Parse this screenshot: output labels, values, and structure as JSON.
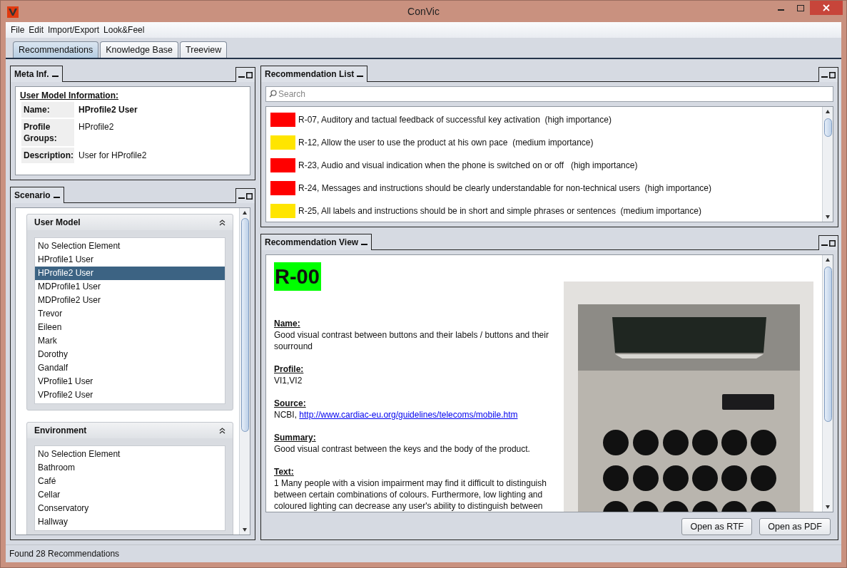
{
  "window": {
    "title": "ConVic"
  },
  "menu": [
    "File",
    "Edit",
    "Import/Export",
    "Look&Feel"
  ],
  "tabs": [
    {
      "label": "Recommendations",
      "selected": true
    },
    {
      "label": "Knowledge Base",
      "selected": false
    },
    {
      "label": "Treeview",
      "selected": false
    }
  ],
  "meta_panel": {
    "title": "Meta Inf.",
    "heading": "User Model Information:",
    "fields": [
      {
        "label": "Name:",
        "value": "HProfile2 User",
        "bold": true
      },
      {
        "label": "Profile Groups:",
        "value": "HProfile2",
        "bold": false
      },
      {
        "label": "Description:",
        "value": "User for HProfile2",
        "bold": false
      }
    ]
  },
  "scenario_panel": {
    "title": "Scenario",
    "sections": [
      {
        "title": "User Model",
        "expanded": true,
        "items": [
          {
            "label": "No Selection Element",
            "selected": false
          },
          {
            "label": "HProfile1 User",
            "selected": false
          },
          {
            "label": "HProfile2 User",
            "selected": true
          },
          {
            "label": "MDProfile1 User",
            "selected": false
          },
          {
            "label": "MDProfile2 User",
            "selected": false
          },
          {
            "label": "Trevor",
            "selected": false
          },
          {
            "label": "Eileen",
            "selected": false
          },
          {
            "label": "Mark",
            "selected": false
          },
          {
            "label": "Dorothy",
            "selected": false
          },
          {
            "label": "Gandalf",
            "selected": false
          },
          {
            "label": "VProfile1 User",
            "selected": false
          },
          {
            "label": "VProfile2 User",
            "selected": false
          }
        ]
      },
      {
        "title": "Environment",
        "expanded": true,
        "items": [
          {
            "label": "No Selection Element",
            "selected": false
          },
          {
            "label": "Bathroom",
            "selected": false
          },
          {
            "label": "Café",
            "selected": false
          },
          {
            "label": "Cellar",
            "selected": false
          },
          {
            "label": "Conservatory",
            "selected": false
          },
          {
            "label": "Hallway",
            "selected": false
          }
        ]
      }
    ]
  },
  "recommendation_list": {
    "title": "Recommendation List",
    "search": {
      "placeholder": "Search"
    },
    "items": [
      {
        "text": "R-07, Auditory and tactual feedback of successful key activation  (high importance)",
        "color": "#ff0000"
      },
      {
        "text": "R-12, Allow the user to use the product at his own pace  (medium importance)",
        "color": "#ffe500"
      },
      {
        "text": "R-23, Audio and visual indication when the phone is switched on or off   (high importance)",
        "color": "#ff0000"
      },
      {
        "text": "R-24, Messages and instructions should be clearly understandable for non-technical users  (high importance)",
        "color": "#ff0000"
      },
      {
        "text": "R-25, All labels and instructions should be in short and simple phrases or sentences  (medium importance)",
        "color": "#ffe500"
      }
    ]
  },
  "recommendation_view": {
    "title": "Recommendation View",
    "id": "R-00",
    "picture": {
      "kind": "picture"
    },
    "sections": [
      {
        "label": "Name:",
        "text": "Good visual contrast between buttons and their labels / buttons and their sourround"
      },
      {
        "label": "Profile:",
        "text": "VI1,VI2"
      },
      {
        "label": "Source:",
        "text": "NCBI, ",
        "link": "http://www.cardiac-eu.org/guidelines/telecoms/mobile.htm"
      },
      {
        "label": "Summary:",
        "text": "Good visual contrast between the keys and the body of the product."
      },
      {
        "label": "Text:",
        "text": "1 Many people with a vision impairment may find it difficult to distinguish between certain combinations of colours. Furthermore, low lighting and coloured lighting can decrease any user's ability to distinguish between"
      }
    ],
    "buttons": [
      "Open as RTF",
      "Open as PDF"
    ]
  },
  "status_bar": "Found 28 Recommendations"
}
